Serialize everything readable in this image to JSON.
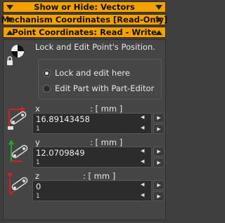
{
  "headers": [
    {
      "label": "Show or Hide: Vectors",
      "arrow": "down"
    },
    {
      "label": "Mechanism Coordinates [Read-Only]",
      "arrow": "down"
    },
    {
      "label": "Point Coordinates: Read - Write",
      "arrow": "up"
    }
  ],
  "panel": {
    "title": "Lock and Edit Point's Position.",
    "radio_options": [
      {
        "label": "Lock and edit here",
        "selected": true
      },
      {
        "label": "Edit Part with Part-Editor",
        "selected": false
      }
    ]
  },
  "coordinates": [
    {
      "axis": "x",
      "unit": ": [ mm ]",
      "value": "16.89143458",
      "step": "1",
      "axis_color": "#cc2222"
    },
    {
      "axis": "y",
      "unit": ": [ mm ]",
      "value": "12.0709849",
      "step": "1",
      "axis_color": "#22aa22"
    },
    {
      "axis": "z",
      "unit": ": [ mm ]",
      "value": "0",
      "step": "1",
      "axis_color": "#cc2222"
    }
  ],
  "colors": {
    "header_bg": "#f2a100",
    "panel_bg": "#454545",
    "field_bg": "#2c2c2c"
  }
}
